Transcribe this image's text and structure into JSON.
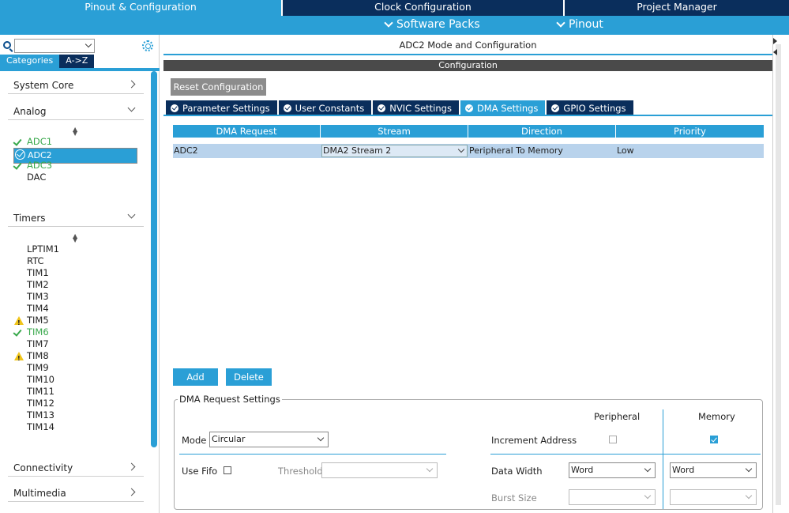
{
  "top_tabs": [
    {
      "label": "Pinout & Configuration",
      "active": true
    },
    {
      "label": "Clock Configuration",
      "active": false
    },
    {
      "label": "Project Manager",
      "active": false
    }
  ],
  "sub_menu": {
    "software_packs": "Software Packs",
    "pinout": "Pinout"
  },
  "left": {
    "search_value": "",
    "tabs": {
      "categories": "Categories",
      "az": "A->Z"
    },
    "sections": {
      "system_core": "System Core",
      "analog": "Analog",
      "timers": "Timers",
      "connectivity": "Connectivity",
      "multimedia": "Multimedia"
    },
    "analog_items": [
      {
        "label": "ADC1",
        "status": "ok"
      },
      {
        "label": "ADC2",
        "status": "selected"
      },
      {
        "label": "ADC3",
        "status": "ok"
      },
      {
        "label": "DAC",
        "status": "none"
      }
    ],
    "timer_items": [
      {
        "label": "LPTIM1",
        "status": "none"
      },
      {
        "label": "RTC",
        "status": "none"
      },
      {
        "label": "TIM1",
        "status": "none"
      },
      {
        "label": "TIM2",
        "status": "none"
      },
      {
        "label": "TIM3",
        "status": "none"
      },
      {
        "label": "TIM4",
        "status": "none"
      },
      {
        "label": "TIM5",
        "status": "warning"
      },
      {
        "label": "TIM6",
        "status": "ok"
      },
      {
        "label": "TIM7",
        "status": "none"
      },
      {
        "label": "TIM8",
        "status": "warning"
      },
      {
        "label": "TIM9",
        "status": "none"
      },
      {
        "label": "TIM10",
        "status": "none"
      },
      {
        "label": "TIM11",
        "status": "none"
      },
      {
        "label": "TIM12",
        "status": "none"
      },
      {
        "label": "TIM13",
        "status": "none"
      },
      {
        "label": "TIM14",
        "status": "none"
      }
    ]
  },
  "main": {
    "title": "ADC2 Mode and Configuration",
    "config_bar": "Configuration",
    "reset_button": "Reset Configuration",
    "tabs": [
      {
        "label": "Parameter Settings",
        "active": false
      },
      {
        "label": "User Constants",
        "active": false
      },
      {
        "label": "NVIC Settings",
        "active": false
      },
      {
        "label": "DMA Settings",
        "active": true
      },
      {
        "label": "GPIO Settings",
        "active": false
      }
    ],
    "table": {
      "headers": [
        "DMA Request",
        "Stream",
        "Direction",
        "Priority"
      ],
      "rows": [
        {
          "request": "ADC2",
          "stream": "DMA2 Stream 2",
          "direction": "Peripheral To Memory",
          "priority": "Low"
        }
      ]
    },
    "add_button": "Add",
    "delete_button": "Delete",
    "request_settings": {
      "legend": "DMA Request Settings",
      "peripheral_header": "Peripheral",
      "memory_header": "Memory",
      "mode_label": "Mode",
      "mode_value": "Circular",
      "increment_label": "Increment Address",
      "peripheral_increment": false,
      "memory_increment": true,
      "use_fifo_label": "Use Fifo",
      "use_fifo": false,
      "threshold_label": "Threshold",
      "threshold_value": "",
      "data_width_label": "Data Width",
      "peripheral_width": "Word",
      "memory_width": "Word",
      "burst_label": "Burst Size",
      "peripheral_burst": "",
      "memory_burst": ""
    }
  },
  "colors": {
    "accent": "#2a9fd6",
    "dark": "#0a2e5c",
    "ok": "#38a84b",
    "warning": "#f0c419"
  }
}
